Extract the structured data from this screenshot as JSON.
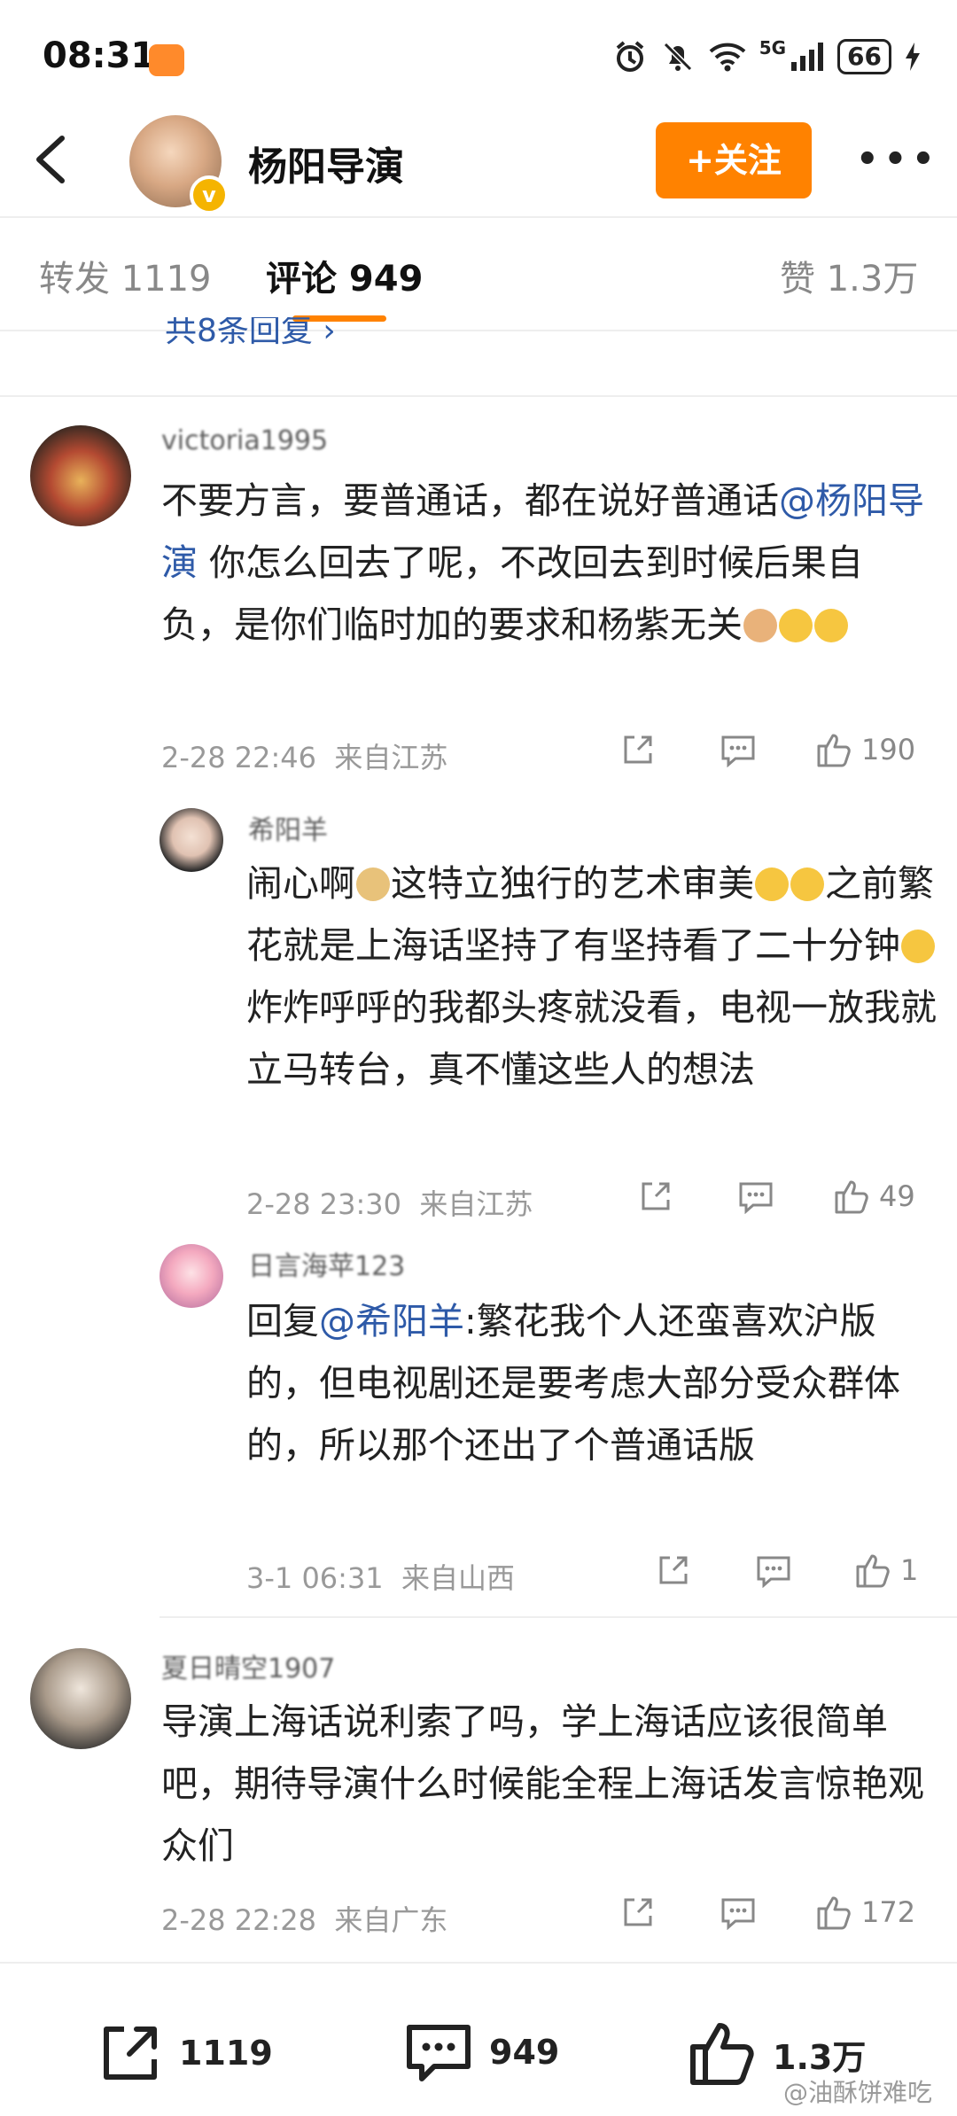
{
  "status_bar": {
    "time": "08:31",
    "network": "5G",
    "battery": "66"
  },
  "header": {
    "title": "杨阳导演",
    "follow_label": "+关注"
  },
  "tabs": [
    {
      "label": "转发 1119"
    },
    {
      "label": "评论 949"
    },
    {
      "label": "赞 1.3万"
    }
  ],
  "thread": {
    "more_replies": "共8条回复 ›"
  },
  "comments": [
    {
      "username": "victoria1995",
      "text_1": "不要方言，要普通话，都在说好普通话",
      "mention": "@杨阳导演",
      "text_2": " 你怎么回去了呢，不改回去到时候后果自负，是你们临时加的要求和杨紫无关",
      "time": "2-28 22:46",
      "location": "来自江苏",
      "likes": "190"
    },
    {
      "username": "希阳羊",
      "text_1": "闹心啊",
      "text_2": "这特立独行的艺术审美",
      "text_3": "之前繁花就是上海话坚持了有坚持看了二十分钟",
      "text_4": "炸炸呼呼的我都头疼就没看，电视一放我就立马转台，真不懂这些人的想法",
      "time": "2-28 23:30",
      "location": "来自江苏",
      "likes": "49"
    },
    {
      "username": "日言海苹123",
      "text_1": "回复",
      "mention": "@希阳羊",
      "text_2": ":繁花我个人还蛮喜欢沪版的，但电视剧还是要考虑大部分受众群体的，所以那个还出了个普通话版",
      "time": "3-1 06:31",
      "location": "来自山西",
      "likes": "1"
    },
    {
      "username": "夏日晴空1907",
      "text": "导演上海话说利索了吗，学上海话应该很简单吧，期待导演什么时候能全程上海话发言惊艳观众们",
      "time": "2-28 22:28",
      "location": "来自广东",
      "likes": "172"
    }
  ],
  "bottom_bar": {
    "repost": "1119",
    "comment": "949",
    "like": "1.3万"
  },
  "watermark": "@油酥饼难吃",
  "colors": {
    "accent": "#ff8200",
    "link": "#2e5aa8",
    "meta": "#999999"
  }
}
